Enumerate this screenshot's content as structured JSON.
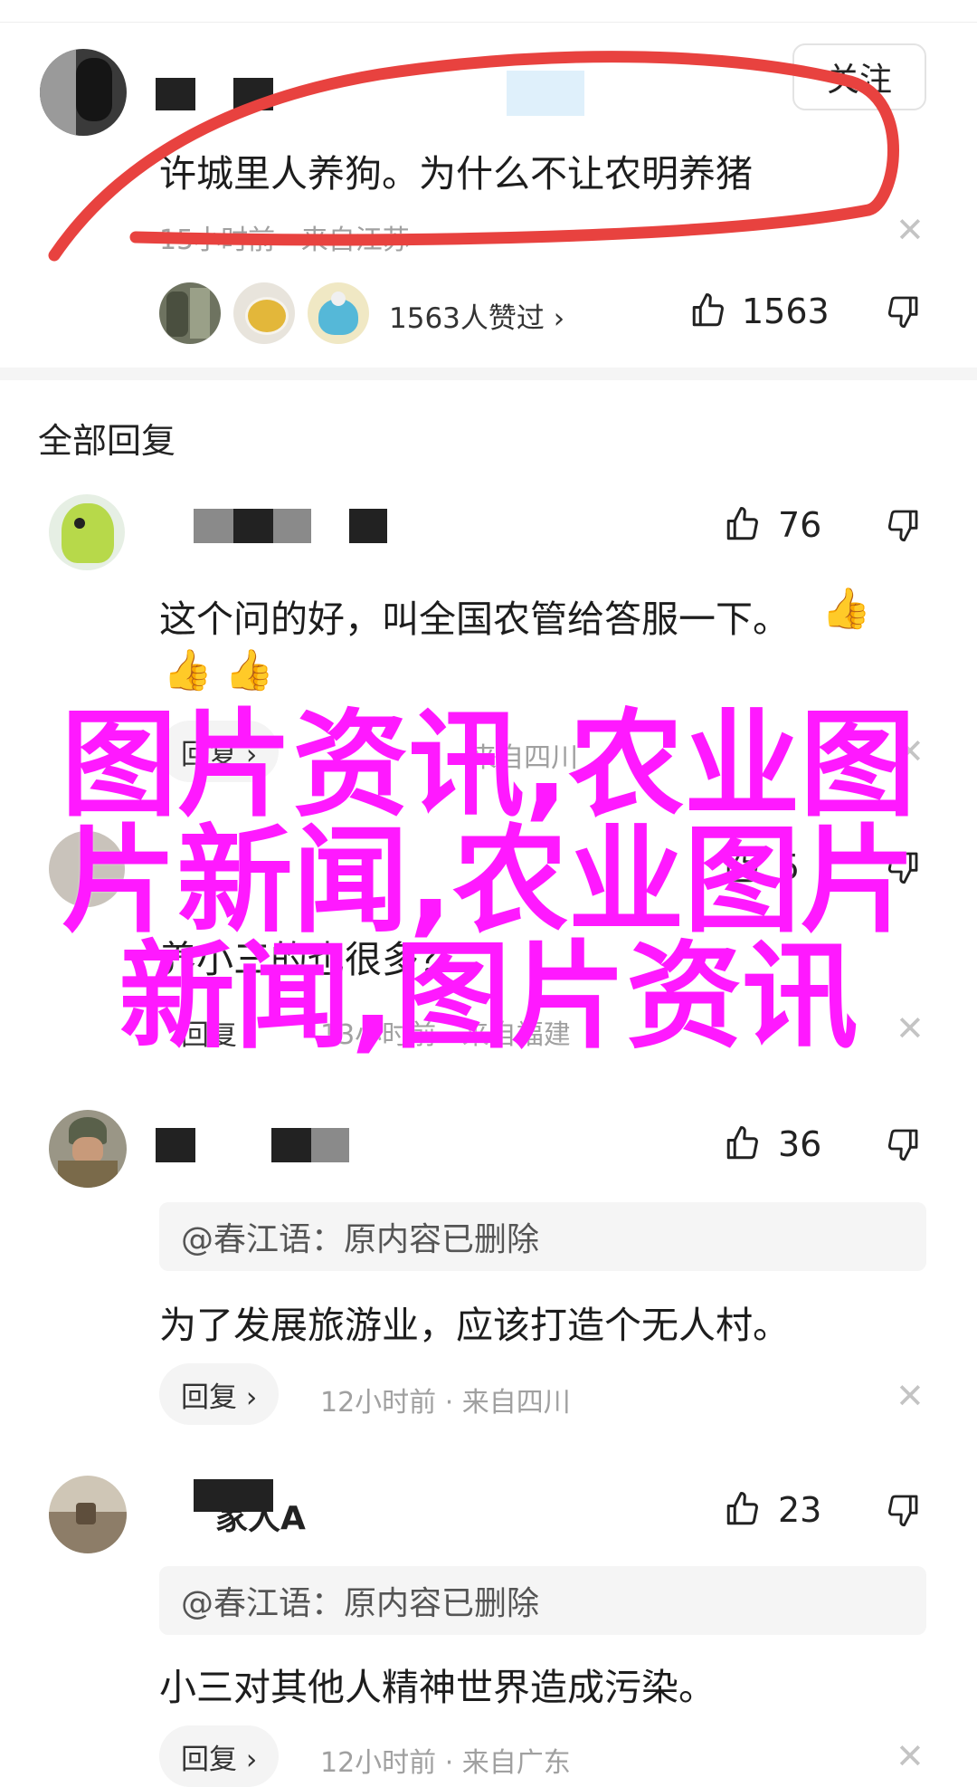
{
  "colors": {
    "overlay": "#ff19ff",
    "annotation": "#e8423f",
    "accent": "#1f1f1f"
  },
  "top_post": {
    "follow_label": "关注",
    "content": "许城里人养狗。为什么不让农明养猪",
    "meta": "15小时前 · 来自江苏",
    "likers_text": "1563人赞过 ›",
    "like_count": "1563"
  },
  "section_title": "全部回复",
  "comments": [
    {
      "text_line1": "这个问的好，叫全国农管给答服一下。",
      "like_count": "76",
      "reply_label": "回复 ›",
      "meta": "· 来自四川"
    },
    {
      "text": "养小三的也很多？",
      "like_count": "5",
      "reply_label": "回复",
      "meta": "13小时前 · 来自福建"
    },
    {
      "quote": "@春江语：原内容已删除",
      "text": "为了发展旅游业，应该打造个无人村。",
      "like_count": "36",
      "reply_label": "回复 ›",
      "meta": "12小时前 · 来自四川"
    },
    {
      "name_fragment": "家人A",
      "quote": "@春江语：原内容已删除",
      "text": "小三对其他人精神世界造成污染。",
      "like_count": "23",
      "reply_label": "回复 ›",
      "meta": "12小时前 · 来自广东"
    }
  ],
  "overlay": {
    "line1": "图片资讯,农业图",
    "line2": "片新闻,农业图片",
    "line3": "新闻,图片资讯"
  },
  "icons": [
    "like-icon",
    "dislike-icon",
    "close-icon",
    "thumbs-up-emoji"
  ]
}
